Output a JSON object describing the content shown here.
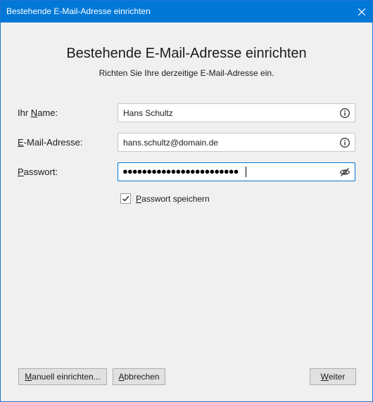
{
  "window": {
    "title": "Bestehende E-Mail-Adresse einrichten"
  },
  "header": {
    "heading": "Bestehende E-Mail-Adresse einrichten",
    "subheading": "Richten Sie Ihre derzeitige E-Mail-Adresse ein."
  },
  "form": {
    "name": {
      "label_pre": "Ihr ",
      "label_key": "N",
      "label_post": "ame:",
      "value": "Hans Schultz",
      "icon": "info-icon"
    },
    "email": {
      "label_pre": "",
      "label_key": "E",
      "label_post": "-Mail-Adresse:",
      "value": "hans.schultz@domain.de",
      "icon": "info-icon"
    },
    "password": {
      "label_pre": "",
      "label_key": "P",
      "label_post": "asswort:",
      "masked_value": "●●●●●●●●●●●●●●●●●●●●●●●●",
      "icon": "eye-slash-icon"
    },
    "remember": {
      "checked": true,
      "label_key": "P",
      "label_post": "asswort speichern"
    }
  },
  "buttons": {
    "manual": {
      "key": "M",
      "rest": "anuell einrichten..."
    },
    "cancel": {
      "key": "A",
      "rest": "bbrechen"
    },
    "next": {
      "key": "W",
      "rest": "eiter"
    }
  },
  "colors": {
    "titlebar": "#0078d7",
    "background": "#f0f0f0",
    "focus_border": "#0078d7"
  }
}
